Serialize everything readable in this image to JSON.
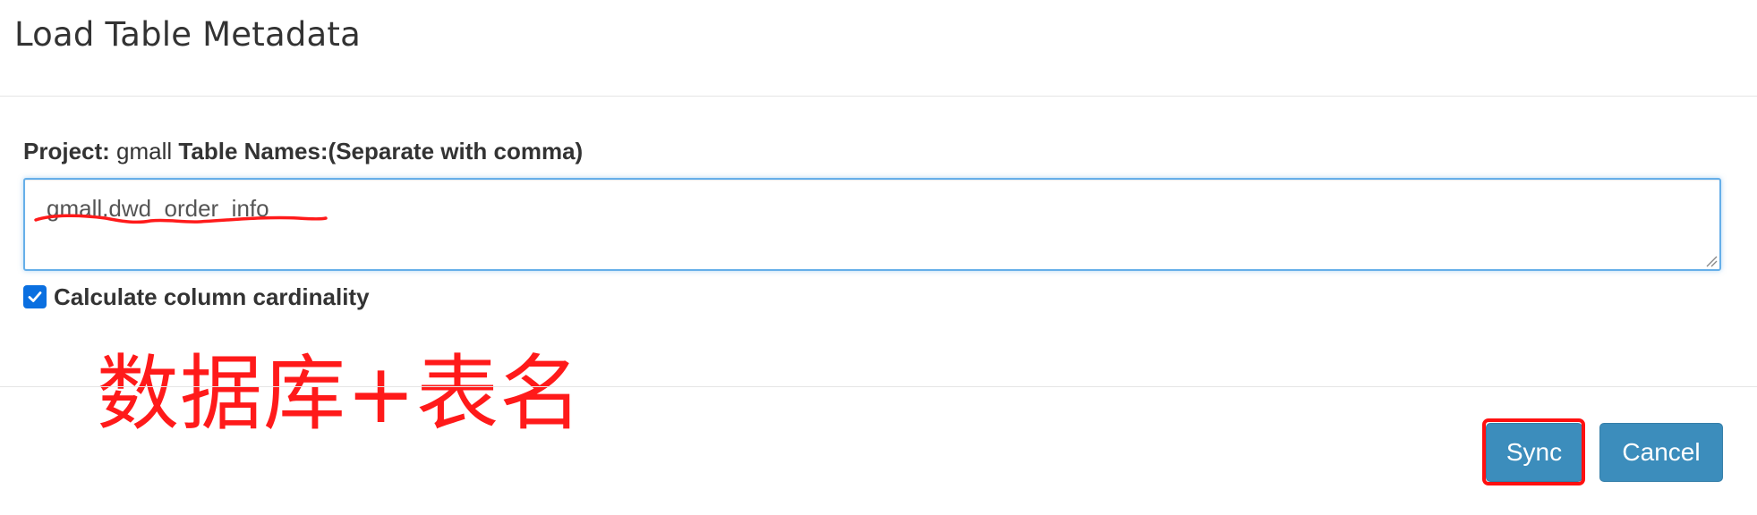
{
  "modal": {
    "title": "Load Table Metadata"
  },
  "form": {
    "project_label": "Project:",
    "project_value": "gmall",
    "table_names_label": "Table Names:(Separate with comma)",
    "table_names_value": "gmall.dwd_order_info",
    "checkbox_label": "Calculate column cardinality",
    "checkbox_checked": true
  },
  "annotation": {
    "text": "数据库+表名",
    "color": "#ff1a1a"
  },
  "footer": {
    "sync_label": "Sync",
    "cancel_label": "Cancel"
  },
  "colors": {
    "button_primary": "#3c8dbc",
    "focus_border": "#66afe9",
    "checkbox": "#0a6fe0",
    "highlight": "#ff1010"
  }
}
